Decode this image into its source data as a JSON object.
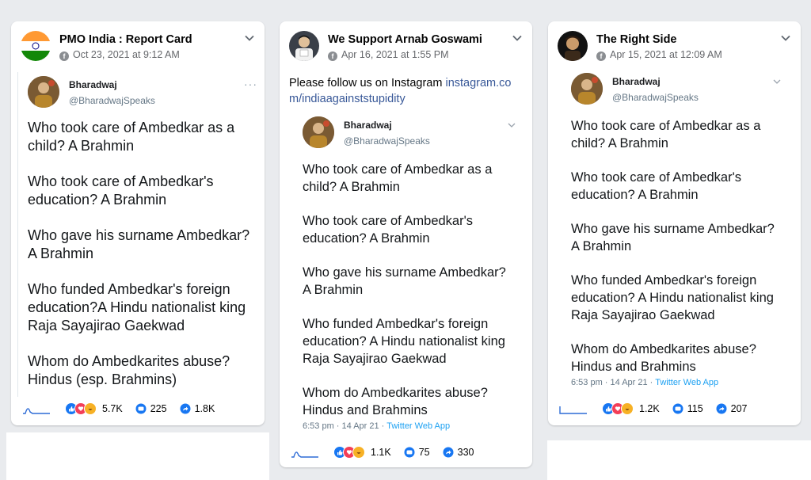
{
  "posts": [
    {
      "page_name": "PMO India : Report Card",
      "date": "Oct 23, 2021 at 9:12 AM",
      "post_text": "",
      "tweet": {
        "name": "Bharadwaj",
        "handle": "@BharadwajSpeaks",
        "paragraphs": [
          "Who took care of Ambedkar as a child? A Brahmin",
          "Who took care of Ambedkar's education? A Brahmin",
          "Who gave his surname Ambedkar? A Brahmin",
          "Who funded Ambedkar's foreign education?A Hindu nationalist king Raja Sayajirao Gaekwad",
          "Whom do Ambedkarites abuse? Hindus (esp. Brahmins)"
        ],
        "meta": ""
      },
      "reactions": "5.7K",
      "comments": "225",
      "shares": "1.8K"
    },
    {
      "page_name": "We Support Arnab Goswami",
      "date": "Apr 16, 2021 at 1:55 PM",
      "post_text": "Please follow us on Instagram ",
      "post_link_1": "instagram.co",
      "post_link_2": "m/indiaagainststupidity",
      "tweet": {
        "name": "Bharadwaj",
        "handle": "@BharadwajSpeaks",
        "paragraphs": [
          "Who took care of Ambedkar as a child? A Brahmin",
          "Who took care of Ambedkar's education? A Brahmin",
          "Who gave his surname Ambedkar? A Brahmin",
          "Who funded Ambedkar's foreign education? A Hindu nationalist king Raja Sayajirao Gaekwad",
          "Whom do Ambedkarites abuse? Hindus and Brahmins"
        ],
        "meta_time": "6:53 pm · 14 Apr 21 · ",
        "meta_source": "Twitter Web App"
      },
      "reactions": "1.1K",
      "comments": "75",
      "shares": "330"
    },
    {
      "page_name": "The Right Side",
      "date": "Apr 15, 2021 at 12:09 AM",
      "post_text": "",
      "tweet": {
        "name": "Bharadwaj",
        "handle": "@BharadwajSpeaks",
        "paragraphs": [
          "Who took care of Ambedkar as a child? A Brahmin",
          "Who took care of Ambedkar's education? A Brahmin",
          "Who gave his surname Ambedkar? A Brahmin",
          "Who funded Ambedkar's foreign education? A Hindu nationalist king Raja Sayajirao Gaekwad",
          "Whom do Ambedkarites abuse? Hindus and Brahmins"
        ],
        "meta_time": "6:53 pm · 14 Apr 21 · ",
        "meta_source": "Twitter Web App"
      },
      "reactions": "1.2K",
      "comments": "115",
      "shares": "207"
    }
  ],
  "colors": {
    "background": "#e9ebee",
    "link": "#385898",
    "twitter_blue": "#1da1f2",
    "like_blue": "#1877f2"
  }
}
